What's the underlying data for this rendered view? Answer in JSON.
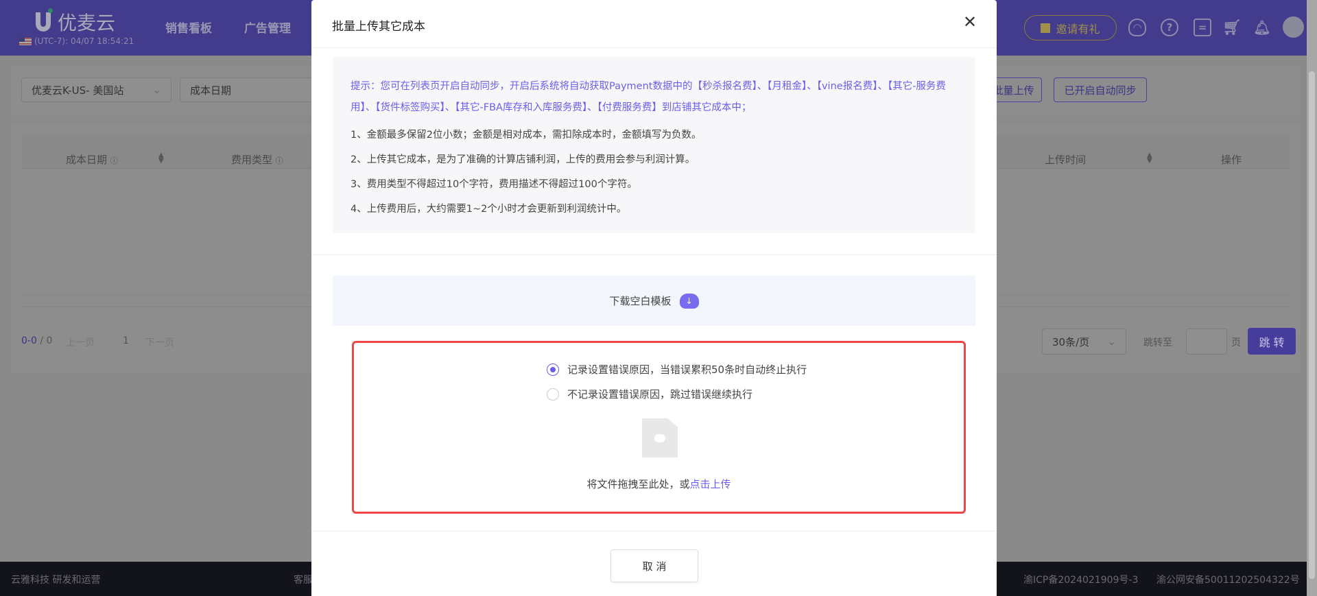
{
  "header": {
    "brand": "优麦云",
    "timezone": "(UTC-7): 04/07 18:54:21",
    "nav": [
      "销售看板",
      "广告管理"
    ],
    "invite_label": "邀请有礼",
    "icons": [
      "headset-icon",
      "help-icon",
      "message-icon",
      "cart-icon",
      "bell-icon",
      "avatar"
    ]
  },
  "filters": {
    "store_select": "优麦云K-US- 美国站",
    "date_type_select": "成本日期",
    "batch_upload_label": "批量上传",
    "auto_sync_label": "已开启自动同步"
  },
  "table": {
    "columns": [
      "成本日期",
      "费用类型",
      "上传时间",
      "操作"
    ]
  },
  "pagination": {
    "range": "0-0",
    "total": "0",
    "prev": "上一页",
    "page": "1",
    "next": "下一页",
    "page_size": "30条/页",
    "jump_label": "跳转至",
    "page_unit": "页",
    "jump_button": "跳 转"
  },
  "footer": {
    "left": "云雅科技 研发和运营",
    "middle": "客服",
    "icp": "渝ICP备2024021909号-3",
    "police": "渝公网安备50011202504322号"
  },
  "modal": {
    "title": "批量上传其它成本",
    "tip": "提示：您可在列表页开启自动同步，开启后系统将自动获取Payment数据中的【秒杀报名费】、【月租金】、【vine报名费】、【其它-服务费用】、【货件标签购买】、【其它-FBA库存和入库服务费】、【付费服务费】到店铺其它成本中；",
    "rules": [
      "1、金额最多保留2位小数；金额是相对成本，需扣除成本时，金额填写为负数。",
      "2、上传其它成本，是为了准确的计算店铺利润，上传的费用会参与利润计算。",
      "3、费用类型不得超过10个字符，费用描述不得超过100个字符。",
      "4、上传费用后，大约需要1~2个小时才会更新到利润统计中。"
    ],
    "download_label": "下载空白模板",
    "options": [
      {
        "label": "记录设置错误原因，当错误累积50条时自动终止执行",
        "selected": true
      },
      {
        "label": "不记录设置错误原因，跳过错误继续执行",
        "selected": false
      }
    ],
    "drop_text": "将文件拖拽至此处，或",
    "drop_link": "点击上传",
    "cancel_label": "取 消"
  },
  "colors": {
    "accent": "#6a5fe8",
    "highlight_border": "#f04545"
  }
}
